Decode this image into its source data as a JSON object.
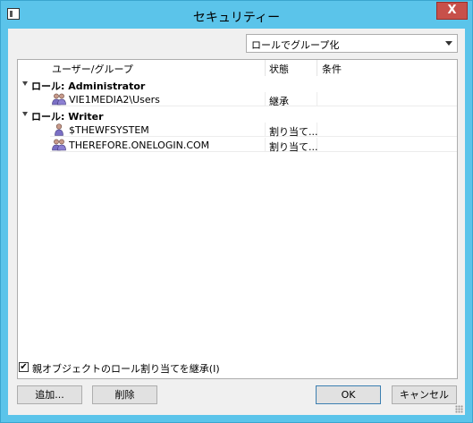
{
  "window": {
    "title": "セキュリティー",
    "close_glyph": "X"
  },
  "toolbar": {
    "group_select": {
      "selected": "ロールでグループ化"
    }
  },
  "tree": {
    "columns": [
      "ユーザー/グループ",
      "状態",
      "条件"
    ],
    "groups": [
      {
        "label": "ロール: Administrator",
        "children": [
          {
            "icon": "user-group-icon",
            "name": "VIE1MEDIA2\\Users",
            "state": "継承",
            "condition": ""
          }
        ]
      },
      {
        "label": "ロール: Writer",
        "children": [
          {
            "icon": "user-icon",
            "name": "$THEWFSYSTEM",
            "state": "割り当て...",
            "condition": ""
          },
          {
            "icon": "user-group-icon",
            "name": "THEREFORE.ONELOGIN.COM",
            "state": "割り当て...",
            "condition": ""
          }
        ]
      }
    ]
  },
  "footer": {
    "inherit_checkbox": {
      "label": "親オブジェクトのロール割り当てを継承(I)",
      "checked": true
    },
    "add_label": "追加...",
    "delete_label": "削除",
    "ok_label": "OK",
    "cancel_label": "キャンセル"
  }
}
